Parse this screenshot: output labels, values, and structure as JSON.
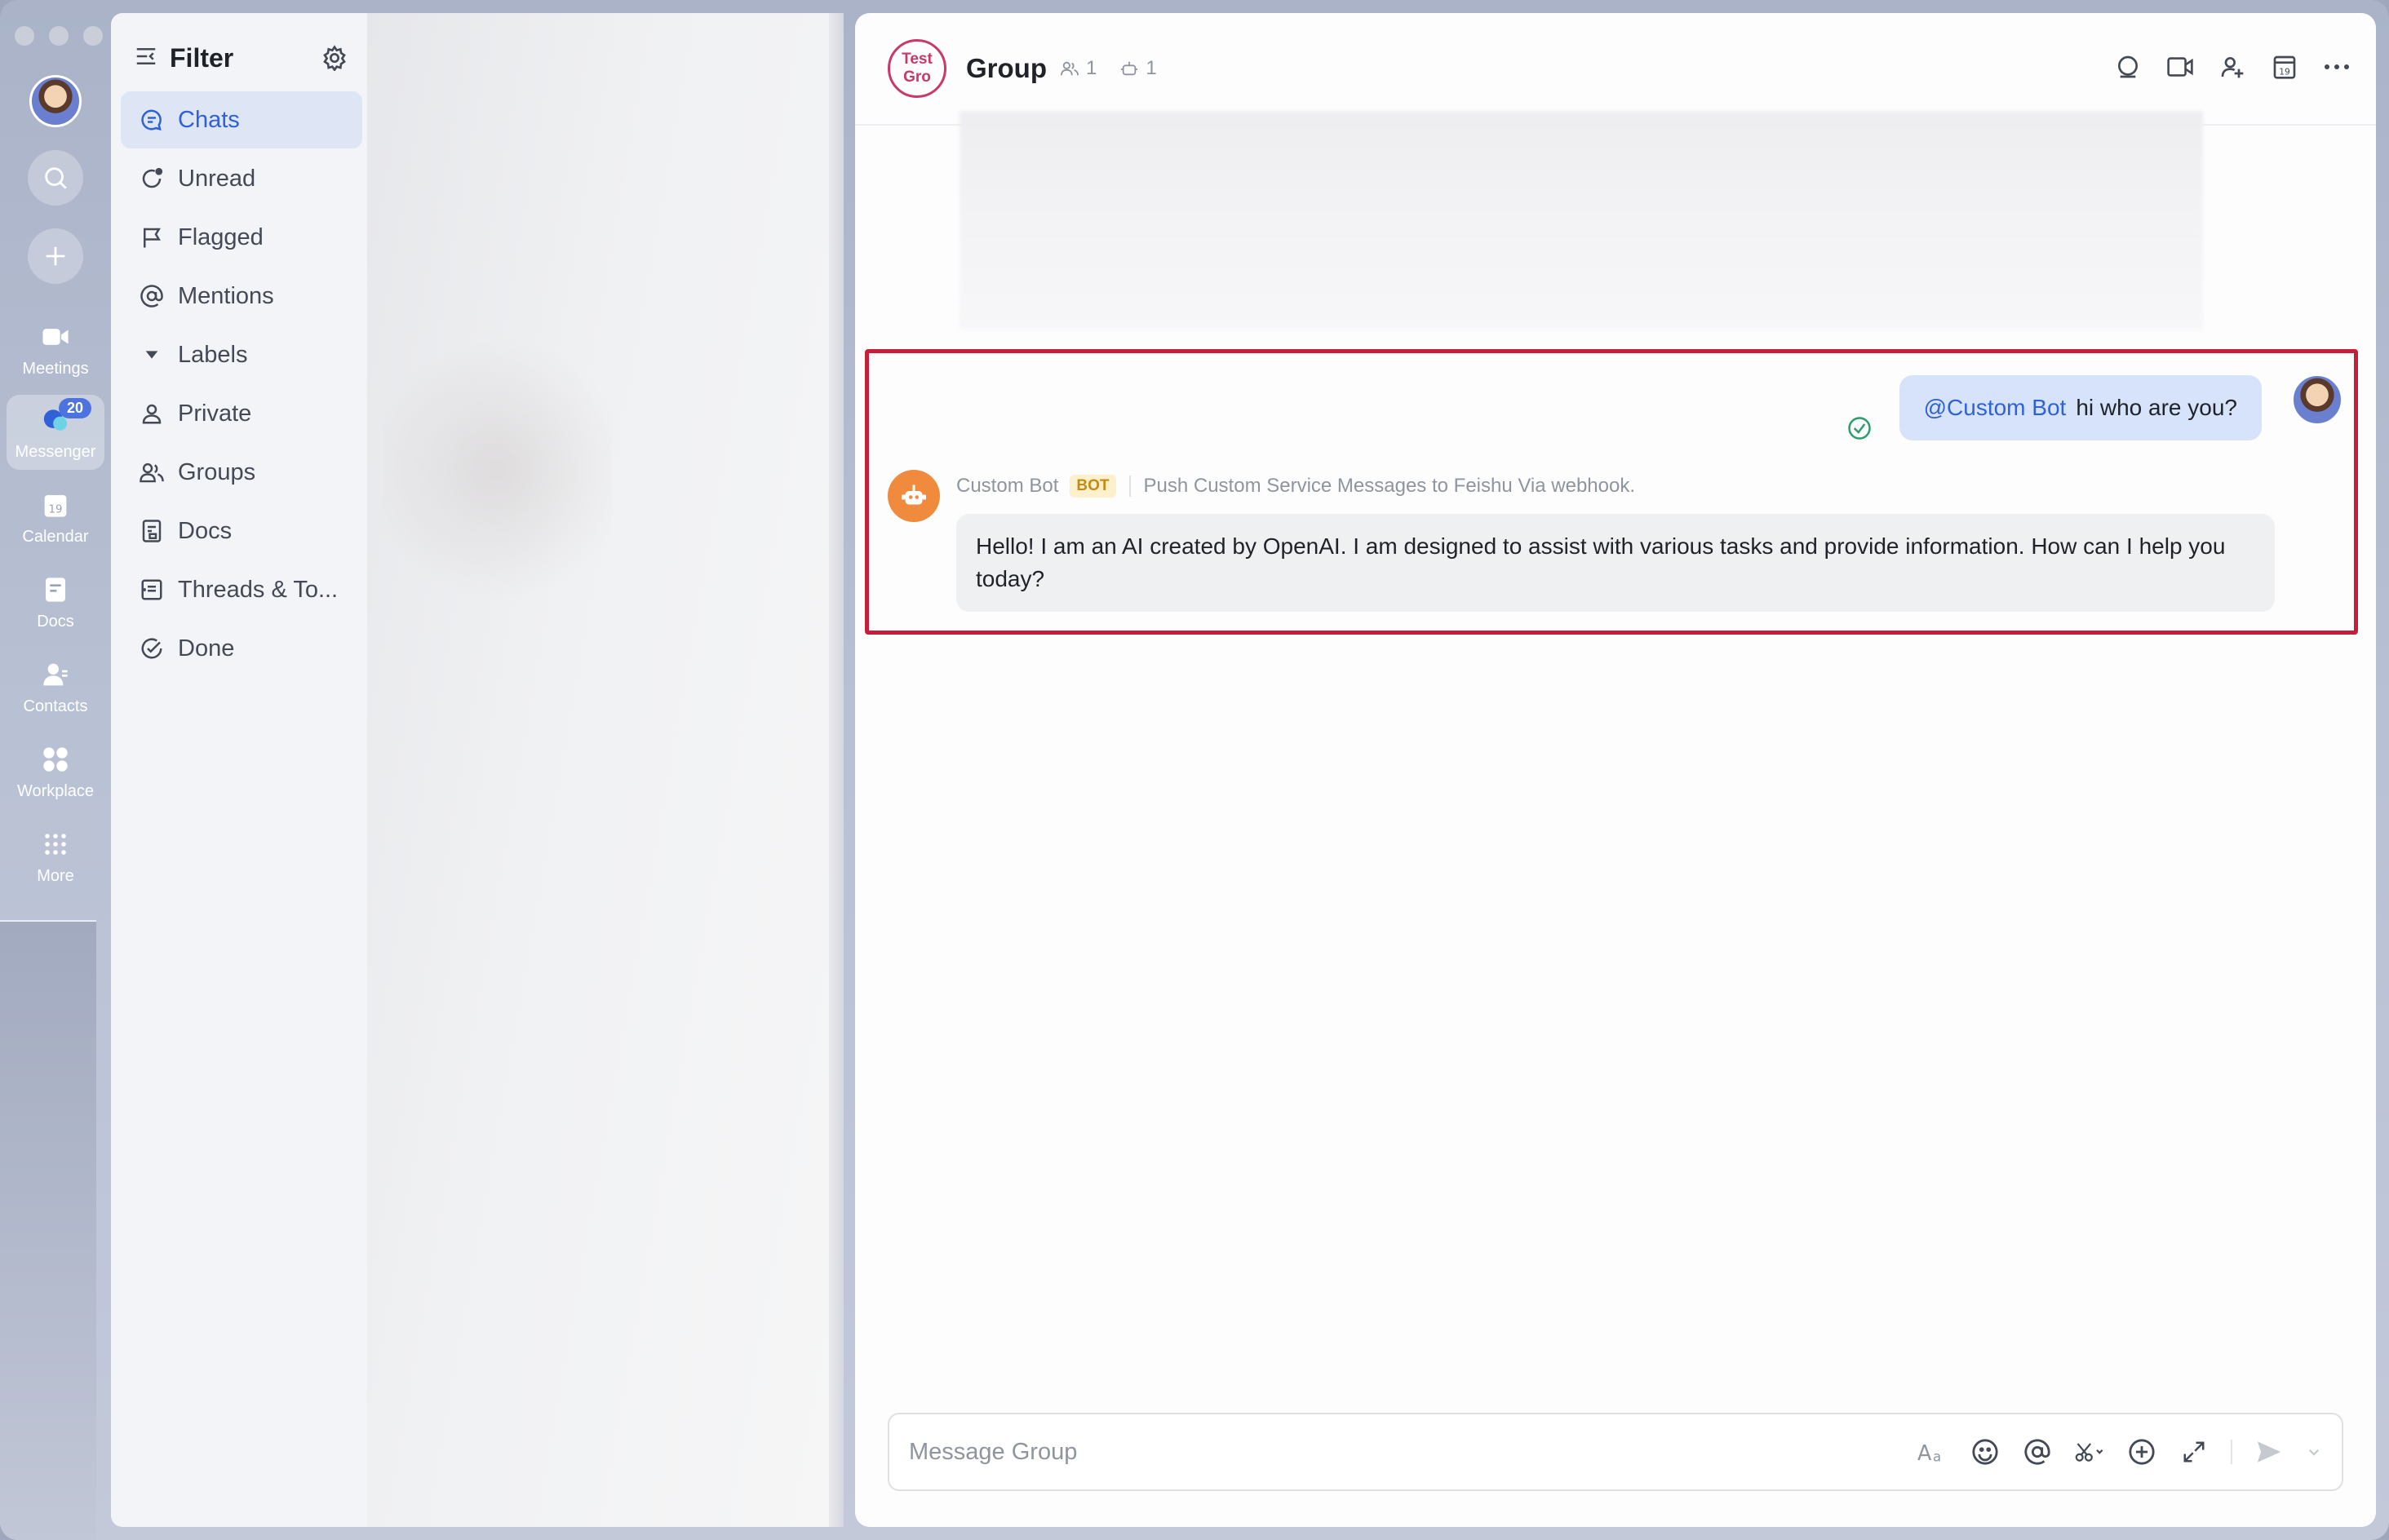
{
  "rail": {
    "items": [
      {
        "label": "Meetings",
        "icon": "video-icon"
      },
      {
        "label": "Messenger",
        "icon": "chat-bubble-icon",
        "badge": "20",
        "active": true
      },
      {
        "label": "Calendar",
        "icon": "calendar-icon",
        "calendar_day": "19"
      },
      {
        "label": "Docs",
        "icon": "docs-icon"
      },
      {
        "label": "Contacts",
        "icon": "contacts-icon"
      },
      {
        "label": "Workplace",
        "icon": "grid-icon"
      },
      {
        "label": "More",
        "icon": "dots-grid-icon"
      }
    ]
  },
  "filter": {
    "title": "Filter",
    "items": [
      {
        "label": "Chats",
        "icon": "chat-icon",
        "active": true
      },
      {
        "label": "Unread",
        "icon": "unread-icon"
      },
      {
        "label": "Flagged",
        "icon": "flag-icon"
      },
      {
        "label": "Mentions",
        "icon": "at-icon"
      },
      {
        "label": "Labels",
        "icon": "caret-down-icon"
      },
      {
        "label": "Private",
        "icon": "person-icon"
      },
      {
        "label": "Groups",
        "icon": "group-icon"
      },
      {
        "label": "Docs",
        "icon": "doc-icon"
      },
      {
        "label": "Threads & To...",
        "icon": "threads-icon"
      },
      {
        "label": "Done",
        "icon": "check-circle-icon"
      }
    ]
  },
  "chat": {
    "avatar_text_line1": "Test",
    "avatar_text_line2": "Gro",
    "title": "Group",
    "member_count": "1",
    "bot_count": "1",
    "my_message": {
      "mention": "@Custom Bot",
      "text": "hi who are you?"
    },
    "bot_message": {
      "sender": "Custom Bot",
      "tag": "BOT",
      "description": "Push Custom Service Messages to Feishu Via webhook.",
      "text": "Hello! I am an AI created by OpenAI. I am designed to assist with various tasks and provide information. How can I help you today?"
    },
    "composer_placeholder": "Message Group"
  },
  "colors": {
    "accent": "#2f62d8",
    "highlight_border": "#c41e3a",
    "bot_avatar": "#f08b3e",
    "group_avatar": "#c9386b"
  }
}
